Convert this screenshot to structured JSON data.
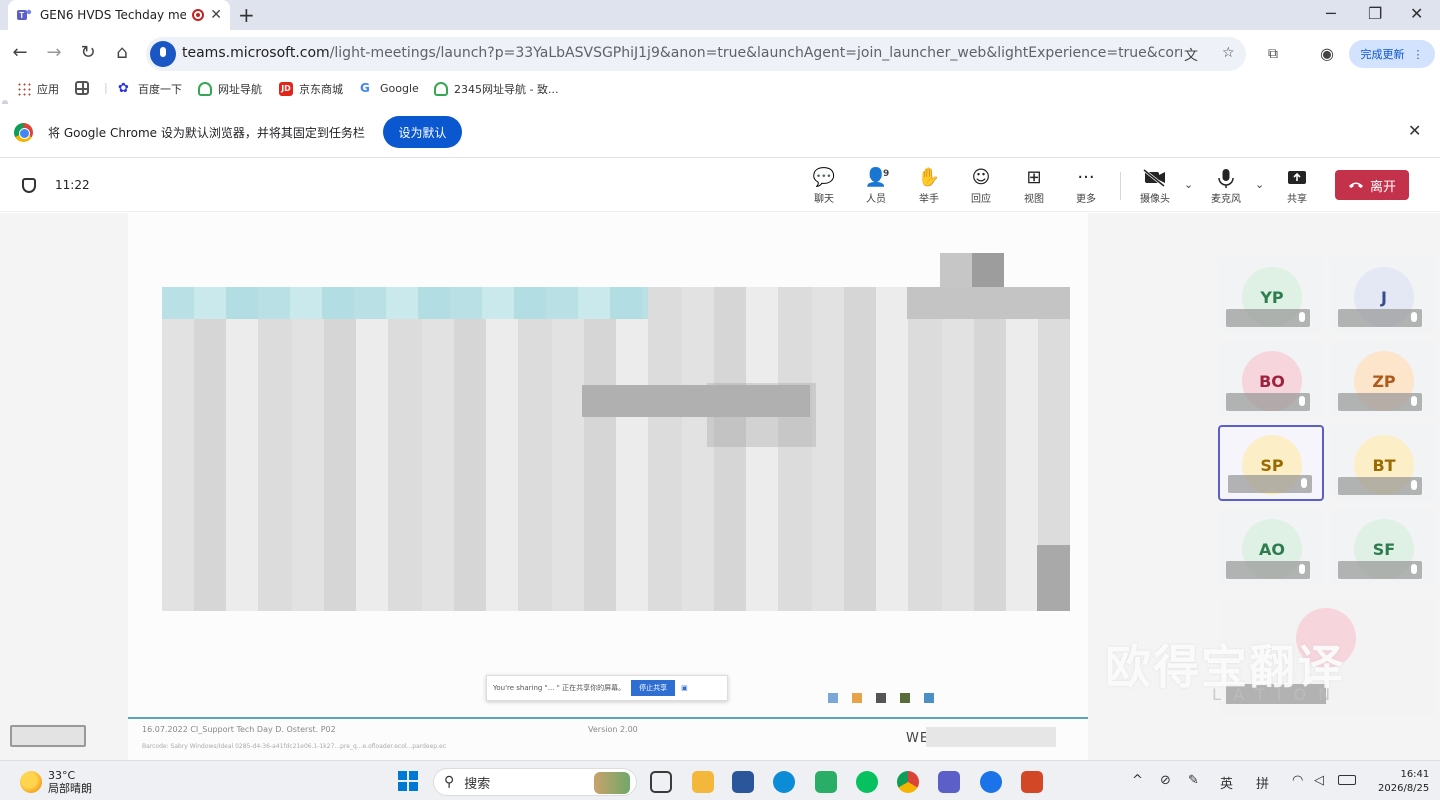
{
  "browser": {
    "tab_title": "GEN6 HVDS Techday me",
    "tab_close": "✕",
    "new_tab": "+",
    "window_controls": {
      "minimize": "─",
      "restore": "❐",
      "close": "✕"
    },
    "nav": {
      "back": "←",
      "forward": "→",
      "reload": "↻",
      "home": "⌂"
    },
    "url_host": "teams.microsoft.com",
    "url_rest": "/light-meetings/launch?p=33YaLbASVSGPhiJ1j9&anon=true&launchAgent=join_launcher_web&lightExperience=true&correlationId=d4...",
    "update_button": "完成更新",
    "menu_glyph": "⋮"
  },
  "bookmarks": [
    {
      "label": "应用",
      "icon": "apps-grid-icon",
      "color": "#d93025"
    },
    {
      "label": "",
      "icon": "grid-icon",
      "color": "#555555"
    },
    {
      "label": "百度一下",
      "icon": "baidu-icon",
      "color": "#2932e1"
    },
    {
      "label": "网址导航",
      "icon": "nav-icon",
      "color": "#34a853"
    },
    {
      "label": "京东商城",
      "icon": "jd-icon",
      "color": "#e1251b"
    },
    {
      "label": "Google",
      "icon": "google-icon",
      "color": "#4285f4"
    },
    {
      "label": "2345网址导航 - 致...",
      "icon": "2345-icon",
      "color": "#34a853"
    }
  ],
  "infobar": {
    "message": "将 Google Chrome 设为默认浏览器，并将其固定到任务栏",
    "button": "设为默认",
    "close": "✕"
  },
  "meeting": {
    "time": "11:22",
    "controls": [
      {
        "label": "聊天",
        "glyph": "💬"
      },
      {
        "label": "人员",
        "glyph": "👤",
        "count": "9"
      },
      {
        "label": "举手",
        "glyph": "✋"
      },
      {
        "label": "回应",
        "glyph": "☺"
      },
      {
        "label": "视图",
        "glyph": "⊞"
      },
      {
        "label": "更多",
        "glyph": "···"
      }
    ],
    "camera_label": "摄像头",
    "mic_label": "麦克风",
    "share_label": "共享",
    "leave_label": "离开",
    "chevron": "⌄"
  },
  "slide": {
    "notice_text": "You're sharing \"... \" 正在共享你的屏幕。",
    "notice_button": "停止共享",
    "footer_left": "16.07.2022 CI_Support Tech Day   D. Osterst. P02",
    "footer_mid": "Version 2.00",
    "footer_small": "Barcode: Sabry Windows/Ideal    0285-d4-36-a41fdc21e06.1-1k27...pre_q...e.ofloader.ecol...pardeep.ec",
    "footer_right": "WE"
  },
  "participants": [
    {
      "initials": "YP",
      "bg": "#dff0e4",
      "fg": "#2e7d4f"
    },
    {
      "initials": "J",
      "bg": "#e4e8f5",
      "fg": "#3a4a8a"
    },
    {
      "initials": "BO",
      "bg": "#f6d5dc",
      "fg": "#a0233e"
    },
    {
      "initials": "ZP",
      "bg": "#fde5cc",
      "fg": "#b0591a"
    },
    {
      "initials": "SP",
      "bg": "#fcefc7",
      "fg": "#9a6b00",
      "active": true
    },
    {
      "initials": "BT",
      "bg": "#fcefc7",
      "fg": "#9a6b00"
    },
    {
      "initials": "AO",
      "bg": "#dff0e4",
      "fg": "#2e7d4f"
    },
    {
      "initials": "SF",
      "bg": "#dff0e4",
      "fg": "#2e7d4f"
    }
  ],
  "watermark": {
    "cn": "欧得宝翻译",
    "en": "LATION"
  },
  "taskbar": {
    "temperature": "33°C",
    "weather": "局部晴朗",
    "search_placeholder": "搜索",
    "apps": [
      {
        "name": "task-view-icon",
        "color": "#3a3a3a"
      },
      {
        "name": "file-explorer-icon",
        "color": "#f3b73b"
      },
      {
        "name": "word-icon",
        "color": "#2b579a"
      },
      {
        "name": "edge-icon",
        "color": "#0c8bd6"
      },
      {
        "name": "wechat-work-icon",
        "color": "#2aae67"
      },
      {
        "name": "wechat-icon",
        "color": "#07c160"
      },
      {
        "name": "chrome-icon",
        "color": "#db4437"
      },
      {
        "name": "teams-icon",
        "color": "#5b5fc7"
      },
      {
        "name": "dictionary-icon",
        "color": "#1a73e8"
      },
      {
        "name": "powerpoint-icon",
        "color": "#d24726"
      }
    ],
    "tray": {
      "chevron": "^",
      "lang": "英",
      "ime": "拼"
    },
    "time": "16:41",
    "date": "2026/8/25"
  }
}
